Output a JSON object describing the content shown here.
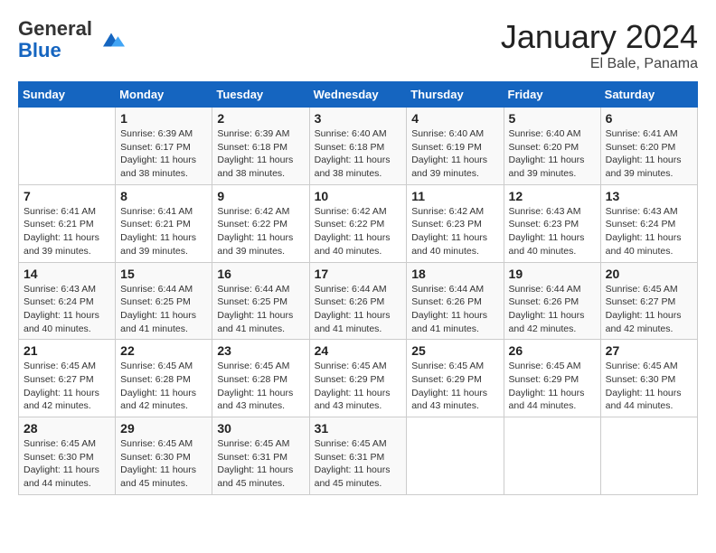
{
  "logo": {
    "general": "General",
    "blue": "Blue"
  },
  "header": {
    "month": "January 2024",
    "location": "El Bale, Panama"
  },
  "weekdays": [
    "Sunday",
    "Monday",
    "Tuesday",
    "Wednesday",
    "Thursday",
    "Friday",
    "Saturday"
  ],
  "weeks": [
    [
      {
        "day": "",
        "sunrise": "",
        "sunset": "",
        "daylight": ""
      },
      {
        "day": "1",
        "sunrise": "Sunrise: 6:39 AM",
        "sunset": "Sunset: 6:17 PM",
        "daylight": "Daylight: 11 hours and 38 minutes."
      },
      {
        "day": "2",
        "sunrise": "Sunrise: 6:39 AM",
        "sunset": "Sunset: 6:18 PM",
        "daylight": "Daylight: 11 hours and 38 minutes."
      },
      {
        "day": "3",
        "sunrise": "Sunrise: 6:40 AM",
        "sunset": "Sunset: 6:18 PM",
        "daylight": "Daylight: 11 hours and 38 minutes."
      },
      {
        "day": "4",
        "sunrise": "Sunrise: 6:40 AM",
        "sunset": "Sunset: 6:19 PM",
        "daylight": "Daylight: 11 hours and 39 minutes."
      },
      {
        "day": "5",
        "sunrise": "Sunrise: 6:40 AM",
        "sunset": "Sunset: 6:20 PM",
        "daylight": "Daylight: 11 hours and 39 minutes."
      },
      {
        "day": "6",
        "sunrise": "Sunrise: 6:41 AM",
        "sunset": "Sunset: 6:20 PM",
        "daylight": "Daylight: 11 hours and 39 minutes."
      }
    ],
    [
      {
        "day": "7",
        "sunrise": "Sunrise: 6:41 AM",
        "sunset": "Sunset: 6:21 PM",
        "daylight": "Daylight: 11 hours and 39 minutes."
      },
      {
        "day": "8",
        "sunrise": "Sunrise: 6:41 AM",
        "sunset": "Sunset: 6:21 PM",
        "daylight": "Daylight: 11 hours and 39 minutes."
      },
      {
        "day": "9",
        "sunrise": "Sunrise: 6:42 AM",
        "sunset": "Sunset: 6:22 PM",
        "daylight": "Daylight: 11 hours and 39 minutes."
      },
      {
        "day": "10",
        "sunrise": "Sunrise: 6:42 AM",
        "sunset": "Sunset: 6:22 PM",
        "daylight": "Daylight: 11 hours and 40 minutes."
      },
      {
        "day": "11",
        "sunrise": "Sunrise: 6:42 AM",
        "sunset": "Sunset: 6:23 PM",
        "daylight": "Daylight: 11 hours and 40 minutes."
      },
      {
        "day": "12",
        "sunrise": "Sunrise: 6:43 AM",
        "sunset": "Sunset: 6:23 PM",
        "daylight": "Daylight: 11 hours and 40 minutes."
      },
      {
        "day": "13",
        "sunrise": "Sunrise: 6:43 AM",
        "sunset": "Sunset: 6:24 PM",
        "daylight": "Daylight: 11 hours and 40 minutes."
      }
    ],
    [
      {
        "day": "14",
        "sunrise": "Sunrise: 6:43 AM",
        "sunset": "Sunset: 6:24 PM",
        "daylight": "Daylight: 11 hours and 40 minutes."
      },
      {
        "day": "15",
        "sunrise": "Sunrise: 6:44 AM",
        "sunset": "Sunset: 6:25 PM",
        "daylight": "Daylight: 11 hours and 41 minutes."
      },
      {
        "day": "16",
        "sunrise": "Sunrise: 6:44 AM",
        "sunset": "Sunset: 6:25 PM",
        "daylight": "Daylight: 11 hours and 41 minutes."
      },
      {
        "day": "17",
        "sunrise": "Sunrise: 6:44 AM",
        "sunset": "Sunset: 6:26 PM",
        "daylight": "Daylight: 11 hours and 41 minutes."
      },
      {
        "day": "18",
        "sunrise": "Sunrise: 6:44 AM",
        "sunset": "Sunset: 6:26 PM",
        "daylight": "Daylight: 11 hours and 41 minutes."
      },
      {
        "day": "19",
        "sunrise": "Sunrise: 6:44 AM",
        "sunset": "Sunset: 6:26 PM",
        "daylight": "Daylight: 11 hours and 42 minutes."
      },
      {
        "day": "20",
        "sunrise": "Sunrise: 6:45 AM",
        "sunset": "Sunset: 6:27 PM",
        "daylight": "Daylight: 11 hours and 42 minutes."
      }
    ],
    [
      {
        "day": "21",
        "sunrise": "Sunrise: 6:45 AM",
        "sunset": "Sunset: 6:27 PM",
        "daylight": "Daylight: 11 hours and 42 minutes."
      },
      {
        "day": "22",
        "sunrise": "Sunrise: 6:45 AM",
        "sunset": "Sunset: 6:28 PM",
        "daylight": "Daylight: 11 hours and 42 minutes."
      },
      {
        "day": "23",
        "sunrise": "Sunrise: 6:45 AM",
        "sunset": "Sunset: 6:28 PM",
        "daylight": "Daylight: 11 hours and 43 minutes."
      },
      {
        "day": "24",
        "sunrise": "Sunrise: 6:45 AM",
        "sunset": "Sunset: 6:29 PM",
        "daylight": "Daylight: 11 hours and 43 minutes."
      },
      {
        "day": "25",
        "sunrise": "Sunrise: 6:45 AM",
        "sunset": "Sunset: 6:29 PM",
        "daylight": "Daylight: 11 hours and 43 minutes."
      },
      {
        "day": "26",
        "sunrise": "Sunrise: 6:45 AM",
        "sunset": "Sunset: 6:29 PM",
        "daylight": "Daylight: 11 hours and 44 minutes."
      },
      {
        "day": "27",
        "sunrise": "Sunrise: 6:45 AM",
        "sunset": "Sunset: 6:30 PM",
        "daylight": "Daylight: 11 hours and 44 minutes."
      }
    ],
    [
      {
        "day": "28",
        "sunrise": "Sunrise: 6:45 AM",
        "sunset": "Sunset: 6:30 PM",
        "daylight": "Daylight: 11 hours and 44 minutes."
      },
      {
        "day": "29",
        "sunrise": "Sunrise: 6:45 AM",
        "sunset": "Sunset: 6:30 PM",
        "daylight": "Daylight: 11 hours and 45 minutes."
      },
      {
        "day": "30",
        "sunrise": "Sunrise: 6:45 AM",
        "sunset": "Sunset: 6:31 PM",
        "daylight": "Daylight: 11 hours and 45 minutes."
      },
      {
        "day": "31",
        "sunrise": "Sunrise: 6:45 AM",
        "sunset": "Sunset: 6:31 PM",
        "daylight": "Daylight: 11 hours and 45 minutes."
      },
      {
        "day": "",
        "sunrise": "",
        "sunset": "",
        "daylight": ""
      },
      {
        "day": "",
        "sunrise": "",
        "sunset": "",
        "daylight": ""
      },
      {
        "day": "",
        "sunrise": "",
        "sunset": "",
        "daylight": ""
      }
    ]
  ]
}
